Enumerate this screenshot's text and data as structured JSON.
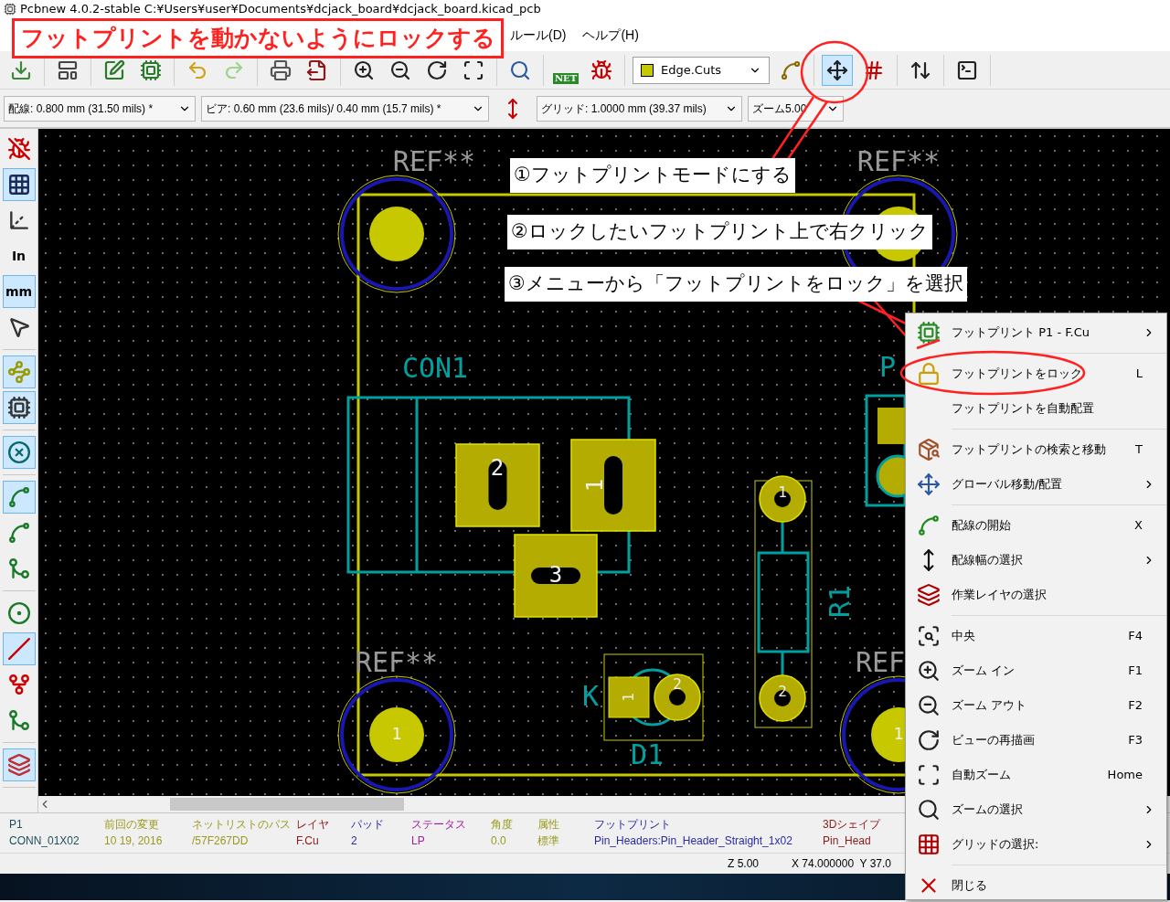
{
  "window": {
    "title": "Pcbnew 4.0.2-stable C:¥Users¥user¥Documents¥dcjack_board¥dcjack_board.kicad_pcb"
  },
  "menu": [
    "ルール(D)",
    "ヘルプ(H)"
  ],
  "banner": "フットプリントを動かないようにロックする",
  "toolbar": [
    [
      {
        "kind": "button",
        "selected": false
      }
    ],
    [
      {
        "kind": "button",
        "selected": false
      }
    ],
    [
      {
        "kind": "button",
        "selected": false
      },
      {
        "kind": "button",
        "selected": false
      }
    ],
    [
      {
        "kind": "button",
        "selected": false
      },
      {
        "kind": "button",
        "selected": false
      }
    ],
    [
      {
        "kind": "button",
        "selected": false
      },
      {
        "kind": "button",
        "selected": false
      }
    ],
    [
      {
        "kind": "button",
        "selected": false
      },
      {
        "kind": "button",
        "selected": false
      },
      {
        "kind": "button",
        "selected": false
      },
      {
        "kind": "button",
        "selected": false
      }
    ],
    [
      {
        "kind": "button",
        "selected": false
      }
    ],
    [
      {
        "kind": "netlist",
        "text": "NET",
        "selected": false
      },
      {
        "kind": "button",
        "selected": false
      }
    ],
    [
      {
        "kind": "layer_select",
        "value": "Edge.Cuts"
      },
      {
        "kind": "button",
        "selected": false
      }
    ],
    [
      {
        "kind": "button",
        "selected": true
      },
      {
        "kind": "button",
        "selected": false
      }
    ],
    [
      {
        "kind": "button",
        "selected": false
      }
    ],
    [
      {
        "kind": "button",
        "selected": false
      }
    ]
  ],
  "toolbar2": [
    {
      "kind": "select",
      "value": "配線: 0.800 mm (31.50 mils) *"
    },
    {
      "kind": "select",
      "value": "ビア: 0.60 mm (23.6 mils)/ 0.40 mm (15.7 mils) *"
    },
    {
      "kind": "button",
      "selected": false
    },
    {
      "kind": "select",
      "value": "グリッド: 1.0000 mm (39.37 mils)"
    },
    {
      "kind": "select",
      "value": "ズーム5.00"
    }
  ],
  "left_toolbar": [
    [
      {
        "selected": false
      },
      {
        "selected": true
      },
      {
        "selected": false
      },
      {
        "selected": false,
        "text": "In"
      },
      {
        "selected": true,
        "text": "mm"
      },
      {
        "selected": false
      }
    ],
    [
      {
        "selected": true
      },
      {
        "selected": true
      }
    ],
    [
      {
        "selected": true
      }
    ],
    [
      {
        "selected": true
      },
      {
        "selected": false
      },
      {
        "selected": false
      }
    ],
    [
      {
        "selected": false
      },
      {
        "selected": true
      },
      {
        "selected": false
      },
      {
        "selected": false
      }
    ],
    [
      {
        "selected": true
      }
    ]
  ],
  "canvas": {
    "texts": [
      "REF**",
      "REF**",
      "REF**",
      "REF",
      "CON1",
      "2",
      "1",
      "3",
      "P",
      "1",
      "2",
      "R1",
      "K",
      "1",
      "2",
      "D1",
      "1",
      "1"
    ]
  },
  "annotations": [
    "①フットプリントモードにする",
    "②ロックしたいフットプリント上で右クリック",
    "③メニューから「フットプリントをロック」を選択"
  ],
  "context_menu": [
    [
      {
        "label": "フットプリント P1 - F.Cu",
        "submenu": true
      }
    ],
    [
      {
        "label": "フットプリントをロック",
        "shortcut": "L"
      },
      {
        "label": "フットプリントを自動配置"
      }
    ],
    [
      {
        "label": "フットプリントの検索と移動",
        "shortcut": "T"
      },
      {
        "label": "グローバル移動/配置",
        "submenu": true
      }
    ],
    [
      {
        "label": "配線の開始",
        "shortcut": "X"
      },
      {
        "label": "配線幅の選択",
        "submenu": true
      },
      {
        "label": "作業レイヤの選択"
      }
    ],
    [
      {
        "label": "中央",
        "shortcut": "F4"
      },
      {
        "label": "ズーム イン",
        "shortcut": "F1"
      },
      {
        "label": "ズーム アウト",
        "shortcut": "F2"
      },
      {
        "label": "ビューの再描画",
        "shortcut": "F3"
      },
      {
        "label": "自動ズーム",
        "shortcut": "Home"
      },
      {
        "label": "ズームの選択",
        "submenu": true
      },
      {
        "label": "グリッドの選択:",
        "submenu": true
      }
    ],
    [
      {
        "label": "閉じる"
      }
    ]
  ],
  "status_fields": [
    {
      "label": "P1",
      "value": "CONN_01X02",
      "color": "#1f4f5f"
    },
    {
      "label": "前回の変更",
      "value": "10 19, 2016",
      "color": "#9a9a20"
    },
    {
      "label": "ネットリストのパス",
      "value": "/57F267DD",
      "color": "#9a9a20"
    },
    {
      "label": "レイヤ",
      "value": "F.Cu",
      "color": "#8b1a1a"
    },
    {
      "label": "パッド",
      "value": "2",
      "color": "#2a2aa0"
    },
    {
      "label": "ステータス",
      "value": "LP",
      "color": "#a020a0"
    },
    {
      "label": "角度",
      "value": "0.0",
      "color": "#9a9a20"
    },
    {
      "label": "属性",
      "value": "標準",
      "color": "#9a9a20"
    },
    {
      "label": "フットプリント",
      "value": "Pin_Headers:Pin_Header_Straight_1x02",
      "color": "#2a2aa0"
    },
    {
      "label": "3Dシェイプ",
      "value": "Pin_Head",
      "color": "#8b1a1a"
    }
  ],
  "coordinates": [
    "Z 5.00",
    "X 74.000000  Y 37.0"
  ]
}
